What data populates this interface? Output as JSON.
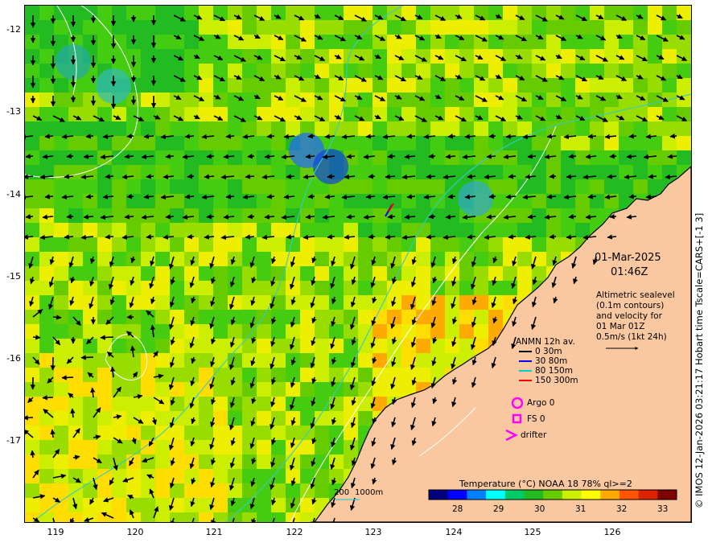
{
  "map": {
    "date": "01-Mar-2025",
    "time": "01:46Z",
    "alt_title_1": "Altimetric sealevel",
    "alt_title_2": "(0.1m contours)",
    "alt_title_3": "and velocity for",
    "alt_title_4": "01 Mar 01Z",
    "alt_scale": "0.5m/s (1kt 24h)",
    "credit": "© IMOS 12-Jan-2026 03:21:17 Hobart time Tscale=CARS+[-1 3]",
    "lat_ticks": [
      "-12",
      "-13",
      "-14",
      "-15",
      "-16",
      "-17"
    ],
    "lon_ticks": [
      "119",
      "120",
      "121",
      "122",
      "123",
      "124",
      "125",
      "126"
    ],
    "lon_range": [
      118.6,
      126.9
    ],
    "lat_range": [
      -17.95,
      -11.75
    ],
    "anmn": {
      "title": "ANMN 12h av.",
      "items": [
        {
          "label": "0 30m",
          "color": "#000000"
        },
        {
          "label": "30 80m",
          "color": "#0000ff"
        },
        {
          "label": "80 150m",
          "color": "#00cccc"
        },
        {
          "label": "150 300m",
          "color": "#ff0000"
        }
      ]
    },
    "argo_label": "Argo 0",
    "fs_label": "FS 0",
    "drifter_label": "drifter",
    "marker_color": "#ff00ff",
    "bathy": {
      "label_200": "200",
      "label_1000": "1000m",
      "color": "#33cccc"
    },
    "colorbar": {
      "title": "Temperature (°C) NOAA 18 78% ql>=2",
      "ticks": [
        "28",
        "29",
        "30",
        "31",
        "32",
        "33"
      ],
      "range": [
        27.4,
        33.3
      ],
      "colors": [
        "#00007f",
        "#0000ff",
        "#007fff",
        "#00ffff",
        "#00cc66",
        "#22bb22",
        "#66cc00",
        "#ccee00",
        "#ffff00",
        "#ffaa00",
        "#ff5500",
        "#dd2200",
        "#7f0000"
      ]
    },
    "land_color": "#fac8a0"
  }
}
